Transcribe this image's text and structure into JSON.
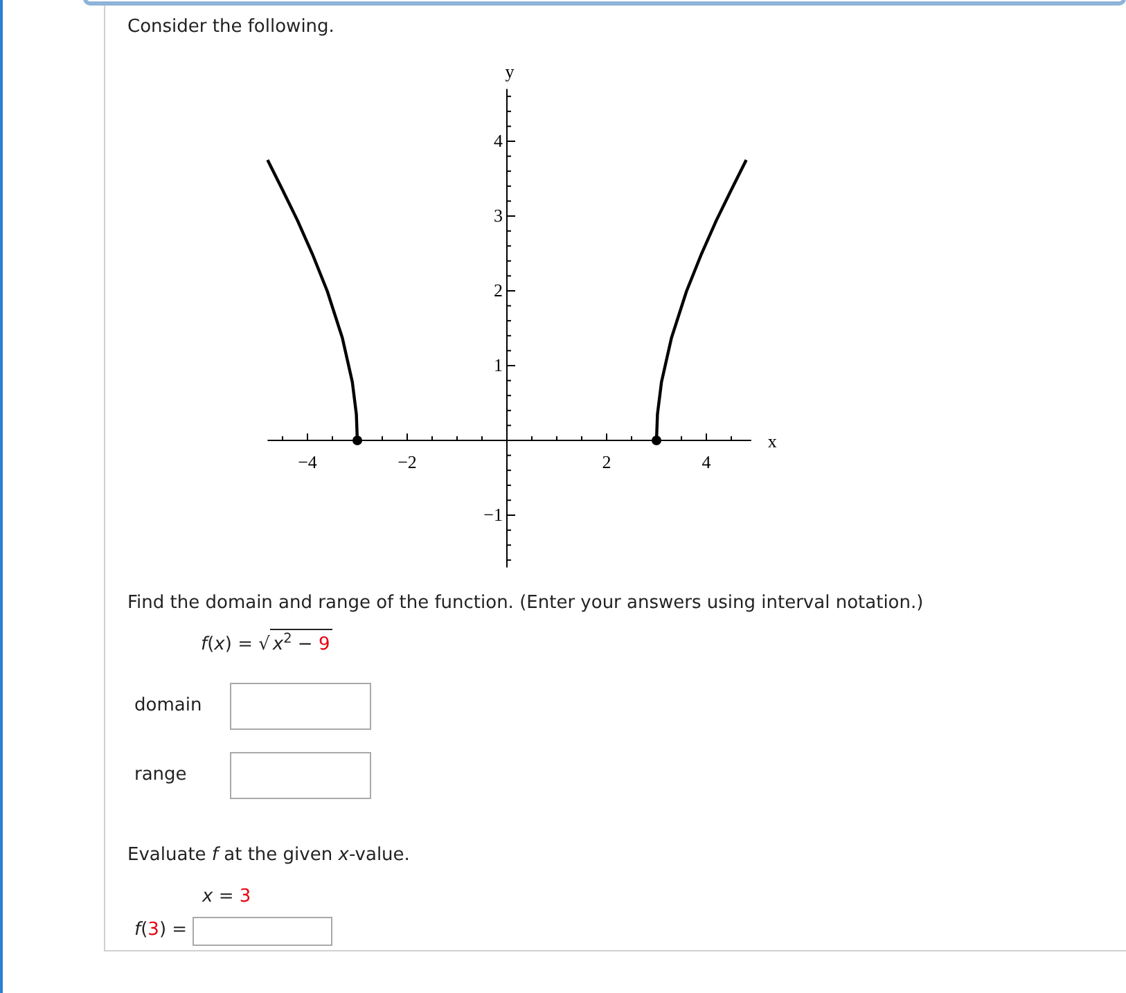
{
  "intro": "Consider the following.",
  "graph": {
    "chart_data": {
      "type": "line",
      "xlabel": "x",
      "ylabel": "y",
      "xlim": [
        -4.8,
        4.9
      ],
      "ylim": [
        -1.7,
        4.7
      ],
      "xticks": [
        {
          "value": -4,
          "label": "−4"
        },
        {
          "value": -2,
          "label": "−2"
        },
        2,
        4
      ],
      "yticks": [
        {
          "value": -1,
          "label": "−1"
        },
        1,
        2,
        3,
        4
      ],
      "x": [
        -4.8,
        -4.5,
        -4.2,
        -3.9,
        -3.6,
        -3.3,
        -3.1,
        -3.02,
        -3,
        3,
        3.02,
        3.1,
        3.3,
        3.6,
        3.9,
        4.2,
        4.5,
        4.8
      ],
      "series": [
        {
          "color": "#000000",
          "values": [
            3.75,
            3.35,
            2.94,
            2.49,
            1.99,
            1.37,
            0.78,
            0.35,
            0,
            null,
            null,
            null,
            null,
            null,
            null,
            null,
            null,
            null
          ]
        },
        {
          "color": "#000000",
          "values": [
            null,
            null,
            null,
            null,
            null,
            null,
            null,
            null,
            null,
            0,
            0.35,
            0.78,
            1.37,
            1.99,
            2.49,
            2.94,
            3.35,
            3.75
          ]
        }
      ]
    }
  },
  "question": "Find the domain and range of the function. (Enter your answers using interval notation.)",
  "formula": {
    "lhs": "*f*(*x*) =",
    "radical": "√",
    "radicand": "*x*$^{2}$ −",
    "constant": "9"
  },
  "answers": [
    {
      "label": "domain"
    },
    {
      "label": "range"
    }
  ],
  "evaluate": {
    "instruction": "Evaluate *f* at the given *x*-value.",
    "given": {
      "lhs": "*x* =",
      "value": "3"
    },
    "prefix": "*f*(",
    "arg": "3",
    "suffix": ") ="
  }
}
